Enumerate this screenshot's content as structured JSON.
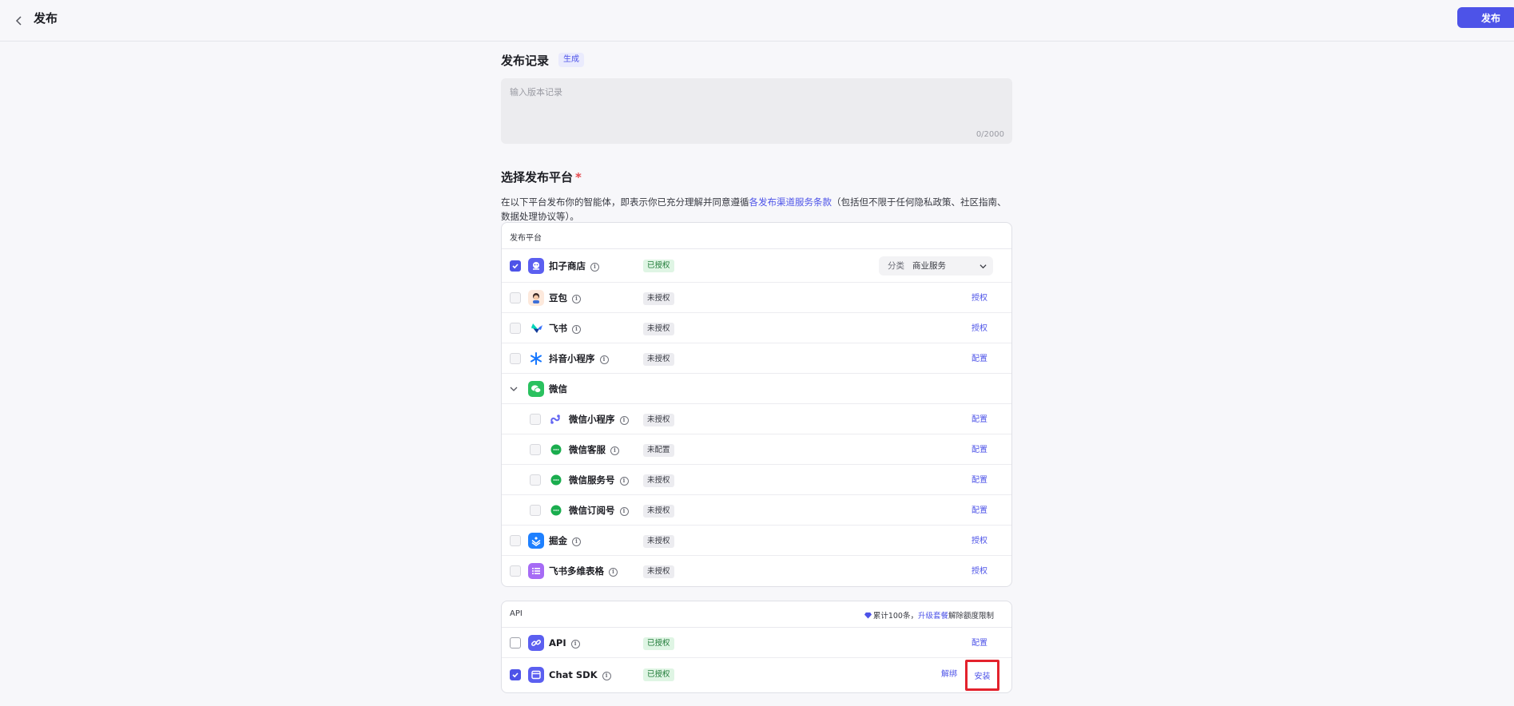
{
  "header": {
    "title": "发布",
    "publish_label": "发布"
  },
  "record": {
    "title": "发布记录",
    "generate_label": "生成",
    "placeholder": "输入版本记录",
    "counter": "0/2000"
  },
  "platform": {
    "title": "选择发布平台",
    "required_mark": "*",
    "desc_before": "在以下平台发布你的智能体，即表示你已充分理解并同意遵循",
    "desc_link": "各发布渠道服务条款",
    "desc_after": "（包括但不限于任何隐私政策、社区指南、数据处理协议等）。",
    "card_header": "发布平台",
    "rows": [
      {
        "name": "扣子商店",
        "badge": "已授权",
        "category_label": "分类",
        "category_value": "商业服务"
      },
      {
        "name": "豆包",
        "badge": "未授权",
        "action": "授权"
      },
      {
        "name": "飞书",
        "badge": "未授权",
        "action": "授权"
      },
      {
        "name": "抖音小程序",
        "badge": "未授权",
        "action": "配置"
      },
      {
        "name": "微信"
      },
      {
        "name": "微信小程序",
        "badge": "未授权",
        "action": "配置"
      },
      {
        "name": "微信客服",
        "badge": "未配置",
        "action": "配置"
      },
      {
        "name": "微信服务号",
        "badge": "未授权",
        "action": "配置"
      },
      {
        "name": "微信订阅号",
        "badge": "未授权",
        "action": "配置"
      },
      {
        "name": "掘金",
        "badge": "未授权",
        "action": "授权"
      },
      {
        "name": "飞书多维表格",
        "badge": "未授权",
        "action": "授权"
      }
    ]
  },
  "api": {
    "card_header": "API",
    "quota_before": "累计100条，",
    "quota_link": "升级套餐",
    "quota_after": "解除额度限制",
    "rows": [
      {
        "name": "API",
        "badge": "已授权",
        "action": "配置"
      },
      {
        "name": "Chat SDK",
        "badge": "已授权",
        "unbind": "解绑",
        "action": "安装"
      }
    ]
  },
  "colors": {
    "accent": "#4d53e8",
    "authorized_bg": "#dff5e4",
    "highlight": "#e3222c"
  }
}
